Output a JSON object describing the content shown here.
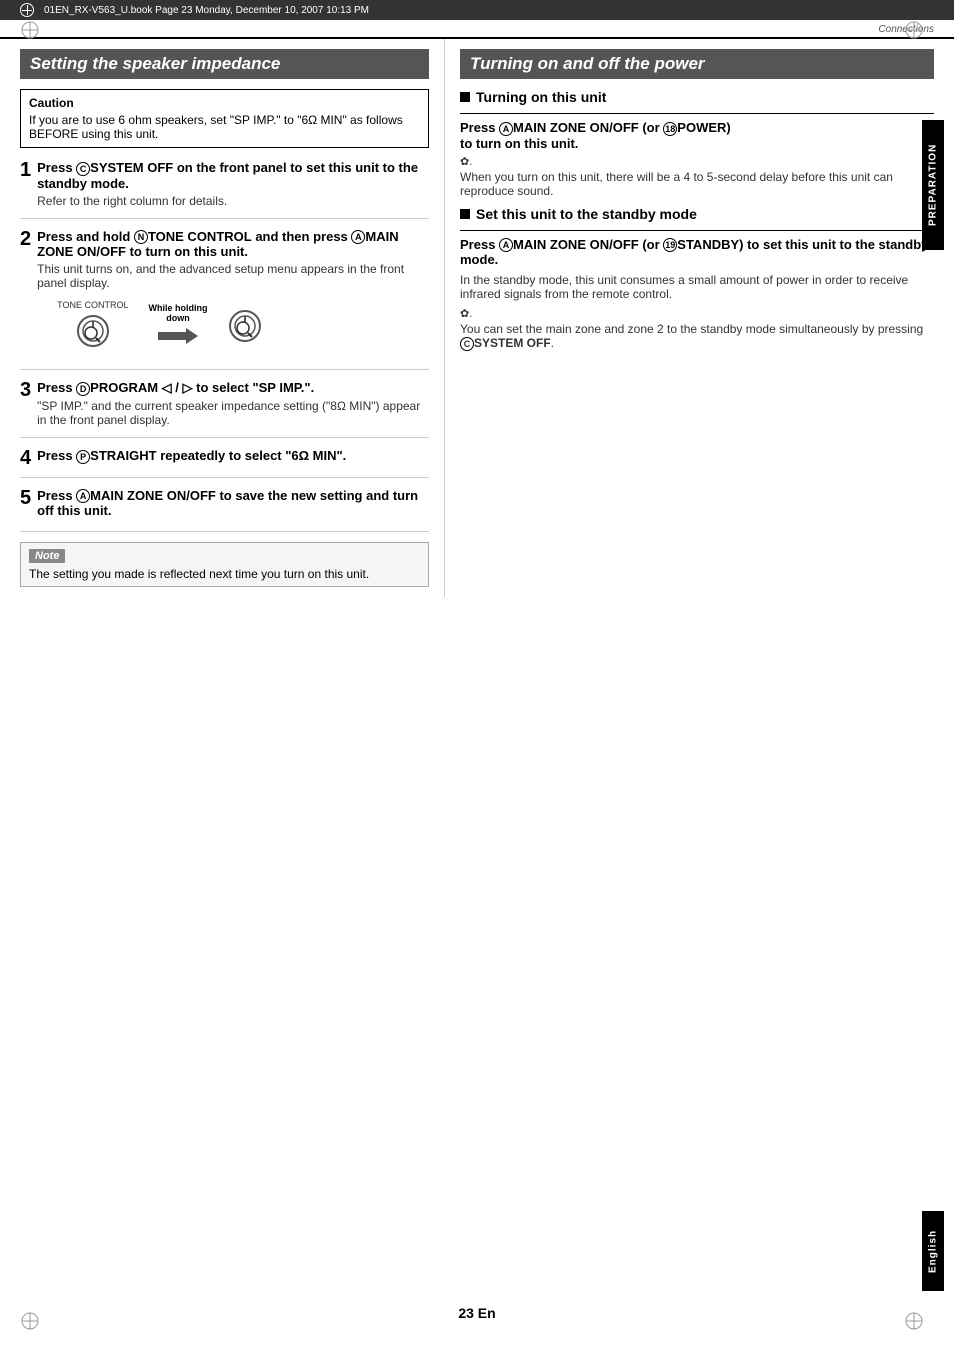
{
  "meta": {
    "file_info": "01EN_RX-V563_U.book  Page 23  Monday, December 10, 2007  10:13 PM",
    "connections_label": "Connections",
    "page_number": "23 En"
  },
  "left_section": {
    "title": "Setting the speaker impedance",
    "caution": {
      "title": "Caution",
      "text": "If you are to use 6 ohm speakers, set \"SP IMP.\" to \"6Ω MIN\" as follows BEFORE using this unit."
    },
    "steps": [
      {
        "number": "1",
        "title": "Press ©SYSTEM OFF on the front panel to set this unit to the standby mode.",
        "desc": "Refer to the right column for details."
      },
      {
        "number": "2",
        "title": "Press and hold ⑩TONE CONTROL and then press ⓐMAIN ZONE ON/OFF to turn on this unit.",
        "desc": "This unit turns on, and the advanced setup menu appears in the front panel display.",
        "has_illustration": true,
        "illus_label": "While holding\ndown",
        "illus_left_label": "TONE CONTROL",
        "illus_right_label": ""
      },
      {
        "number": "3",
        "title": "Press ⓓPROGRAM ◁ / ▷ to select \"SP IMP.\".",
        "desc": "\"SP IMP.\" and the current speaker impedance setting (\"8Ω MIN\") appear in the front panel display."
      },
      {
        "number": "4",
        "title": "Press ⓟSTRAIGHT repeatedly to select \"6Ω MIN\".",
        "desc": ""
      },
      {
        "number": "5",
        "title": "Press ⓐMAIN ZONE ON/OFF to save the new setting and turn off this unit.",
        "desc": ""
      }
    ],
    "note": {
      "title": "Note",
      "text": "The setting you made is reflected next time you turn on this unit."
    }
  },
  "right_section": {
    "title": "Turning on and off the power",
    "subsections": [
      {
        "heading": "Turning on this unit",
        "divider": true,
        "press_instruction": "Press ⓐMAIN ZONE ON/OFF (or ⑱POWER) to turn on this unit.",
        "note_symbol": "✿",
        "note_text": "When you turn on this unit, there will be a 4 to 5-second delay before this unit can reproduce sound."
      },
      {
        "heading": "Set this unit to the standby mode",
        "divider": true,
        "press_instruction": "Press ⓐMAIN ZONE ON/OFF (or ⑲STANDBY) to set this unit to the standby mode.",
        "body_text": "In the standby mode, this unit consumes a small amount of power in order to receive infrared signals from the remote control.",
        "note_symbol": "✿",
        "note_text": "You can set the main zone and zone 2 to the standby mode simultaneously by pressing ©SYSTEM OFF."
      }
    ]
  },
  "sidebar": {
    "preparation_label": "PREPARATION",
    "english_label": "English"
  }
}
